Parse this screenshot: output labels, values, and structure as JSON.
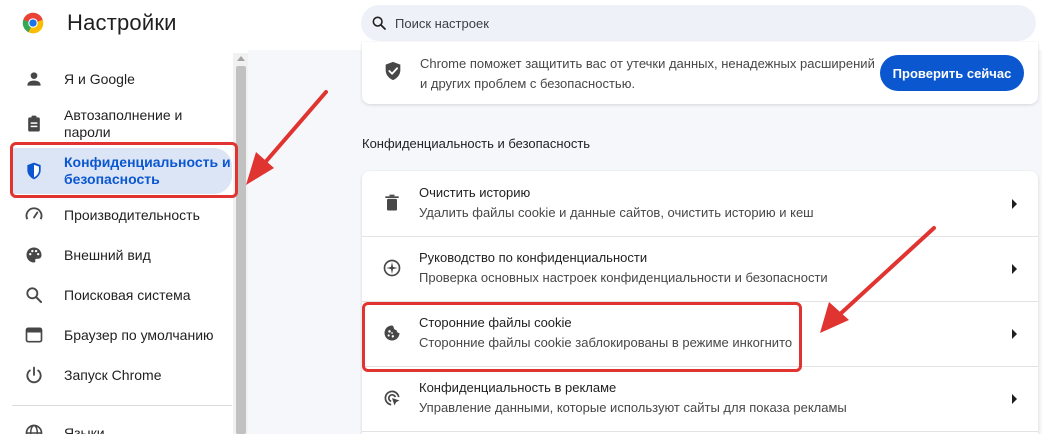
{
  "header": {
    "title": "Настройки",
    "search_placeholder": "Поиск настроек"
  },
  "sidebar": {
    "items": [
      {
        "label": "Я и Google",
        "icon": "person-icon"
      },
      {
        "label": "Автозаполнение и\nпароли",
        "icon": "clipboard-icon"
      },
      {
        "label": "Конфиденциальность и\nбезопасность",
        "icon": "shield-icon",
        "active": true
      },
      {
        "label": "Производительность",
        "icon": "speedometer-icon"
      },
      {
        "label": "Внешний вид",
        "icon": "palette-icon"
      },
      {
        "label": "Поисковая система",
        "icon": "search-icon"
      },
      {
        "label": "Браузер по умолчанию",
        "icon": "browser-window-icon"
      },
      {
        "label": "Запуск Chrome",
        "icon": "power-icon"
      },
      {
        "label": "Языки",
        "icon": "globe-icon"
      }
    ]
  },
  "main": {
    "safety_card": {
      "text": "Chrome поможет защитить вас от утечки данных, ненадежных расширений и других проблем с безопасностью.",
      "button_label": "Проверить сейчас"
    },
    "section_title": "Конфиденциальность и безопасность",
    "rows": [
      {
        "title": "Очистить историю",
        "subtitle": "Удалить файлы cookie и данные сайтов, очистить историю и кеш",
        "icon": "trash-icon"
      },
      {
        "title": "Руководство по конфиденциальности",
        "subtitle": "Проверка основных настроек конфиденциальности и безопасности",
        "icon": "compass-icon"
      },
      {
        "title": "Сторонние файлы cookie",
        "subtitle": "Сторонние файлы cookie заблокированы в режиме инкогнито",
        "icon": "cookie-icon"
      },
      {
        "title": "Конфиденциальность в рекламе",
        "subtitle": "Управление данными, которые используют сайты для показа рекламы",
        "icon": "ads-click-icon"
      }
    ]
  },
  "colors": {
    "accent": "#0b57d0",
    "active_bg": "#dbe5f5",
    "annotation_red": "#e03431",
    "main_bg": "#f5f7fb"
  }
}
